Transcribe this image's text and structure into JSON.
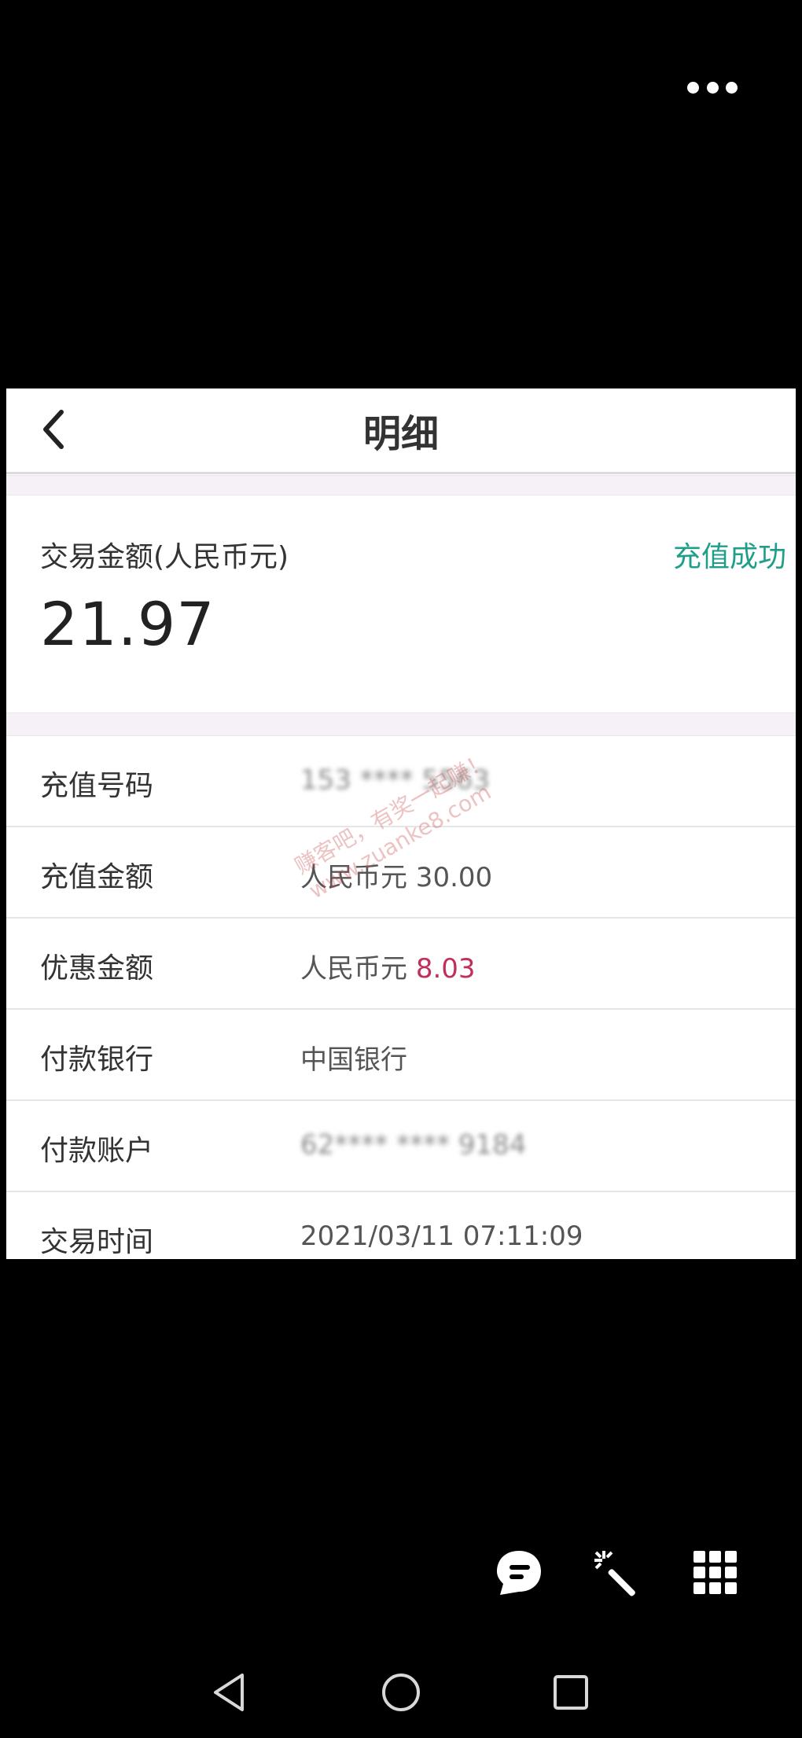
{
  "nav": {
    "title": "明细"
  },
  "summary": {
    "amount_label": "交易金额(人民币元)",
    "amount_value": "21.97",
    "status": "充值成功"
  },
  "details": [
    {
      "label": "充值号码",
      "value": "153 **** 5563"
    },
    {
      "label": "充值金额",
      "value": "人民币元 30.00"
    },
    {
      "label": "优惠金额",
      "currency": "人民币元",
      "value": "8.03"
    },
    {
      "label": "付款银行",
      "value": "中国银行"
    },
    {
      "label": "付款账户",
      "value": "62**** **** 9184"
    },
    {
      "label": "交易时间",
      "value": "2021/03/11 07:11:09"
    }
  ],
  "watermark": {
    "line1": "赚客吧，有奖一起赚！",
    "line2": "www.zuanke8.com"
  },
  "colors": {
    "status": "#1f9e8a",
    "discount": "#c0305a",
    "background": "#000000"
  },
  "icons": {
    "top_right": "more-icon",
    "toolbar": [
      "chat-bubble-icon",
      "magic-wand-icon",
      "grid-icon"
    ],
    "system_nav": [
      "back-triangle-icon",
      "home-circle-icon",
      "recent-square-icon"
    ]
  }
}
